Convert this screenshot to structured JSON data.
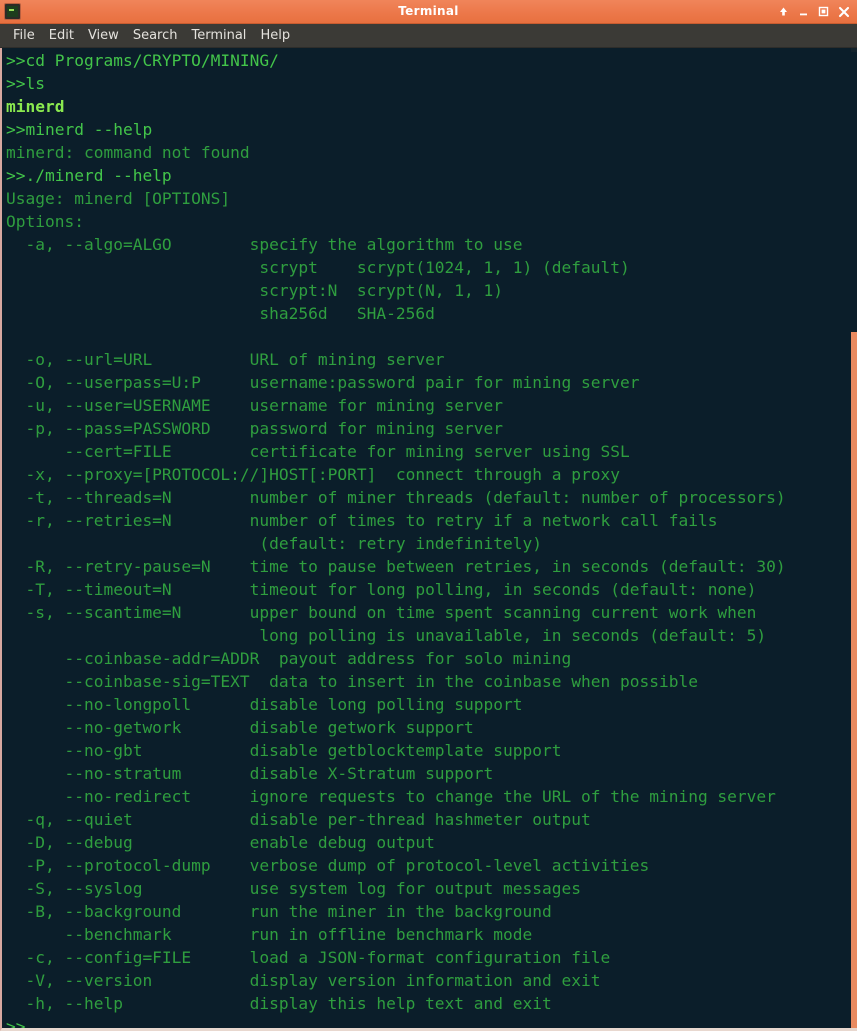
{
  "window": {
    "title": "Terminal",
    "icon": "terminal-icon",
    "accent_color": "#ed7a4d",
    "background_color": "#0b1e2a",
    "text_color": "#2f9e3f",
    "buttons": [
      {
        "name": "shade-button",
        "glyph": "↑"
      },
      {
        "name": "minimize-button",
        "glyph": "–"
      },
      {
        "name": "maximize-button",
        "glyph": "□"
      },
      {
        "name": "close-button",
        "glyph": "✕"
      }
    ]
  },
  "menubar": {
    "items": [
      {
        "label": "File"
      },
      {
        "label": "Edit"
      },
      {
        "label": "View"
      },
      {
        "label": "Search"
      },
      {
        "label": "Terminal"
      },
      {
        "label": "Help"
      }
    ]
  },
  "terminal": {
    "prompt": ">>",
    "scrollbar": {
      "visible": true,
      "thumb_top_pct": 29,
      "thumb_height_pct": 71,
      "color": "#e88a60"
    },
    "lines": [
      {
        "text": ">>cd Programs/CRYPTO/MINING/",
        "style": "cmd"
      },
      {
        "text": ">>ls",
        "style": "cmd"
      },
      {
        "text": "minerd",
        "style": "bright"
      },
      {
        "text": ">>minerd --help",
        "style": "cmd"
      },
      {
        "text": "minerd: command not found",
        "style": "out"
      },
      {
        "text": ">>./minerd --help",
        "style": "cmd"
      },
      {
        "text": "Usage: minerd [OPTIONS]",
        "style": "out"
      },
      {
        "text": "Options:",
        "style": "out"
      },
      {
        "text": "  -a, --algo=ALGO        specify the algorithm to use",
        "style": "out"
      },
      {
        "text": "                          scrypt    scrypt(1024, 1, 1) (default)",
        "style": "out"
      },
      {
        "text": "                          scrypt:N  scrypt(N, 1, 1)",
        "style": "out"
      },
      {
        "text": "                          sha256d   SHA-256d",
        "style": "out"
      },
      {
        "text": "",
        "style": "blank"
      },
      {
        "text": "  -o, --url=URL          URL of mining server",
        "style": "out"
      },
      {
        "text": "  -O, --userpass=U:P     username:password pair for mining server",
        "style": "out"
      },
      {
        "text": "  -u, --user=USERNAME    username for mining server",
        "style": "out"
      },
      {
        "text": "  -p, --pass=PASSWORD    password for mining server",
        "style": "out"
      },
      {
        "text": "      --cert=FILE        certificate for mining server using SSL",
        "style": "out"
      },
      {
        "text": "  -x, --proxy=[PROTOCOL://]HOST[:PORT]  connect through a proxy",
        "style": "out"
      },
      {
        "text": "  -t, --threads=N        number of miner threads (default: number of processors)",
        "style": "out"
      },
      {
        "text": "  -r, --retries=N        number of times to retry if a network call fails",
        "style": "out"
      },
      {
        "text": "                          (default: retry indefinitely)",
        "style": "out"
      },
      {
        "text": "  -R, --retry-pause=N    time to pause between retries, in seconds (default: 30)",
        "style": "out"
      },
      {
        "text": "  -T, --timeout=N        timeout for long polling, in seconds (default: none)",
        "style": "out"
      },
      {
        "text": "  -s, --scantime=N       upper bound on time spent scanning current work when",
        "style": "out"
      },
      {
        "text": "                          long polling is unavailable, in seconds (default: 5)",
        "style": "out"
      },
      {
        "text": "      --coinbase-addr=ADDR  payout address for solo mining",
        "style": "out"
      },
      {
        "text": "      --coinbase-sig=TEXT  data to insert in the coinbase when possible",
        "style": "out"
      },
      {
        "text": "      --no-longpoll      disable long polling support",
        "style": "out"
      },
      {
        "text": "      --no-getwork       disable getwork support",
        "style": "out"
      },
      {
        "text": "      --no-gbt           disable getblocktemplate support",
        "style": "out"
      },
      {
        "text": "      --no-stratum       disable X-Stratum support",
        "style": "out"
      },
      {
        "text": "      --no-redirect      ignore requests to change the URL of the mining server",
        "style": "out"
      },
      {
        "text": "  -q, --quiet            disable per-thread hashmeter output",
        "style": "out"
      },
      {
        "text": "  -D, --debug            enable debug output",
        "style": "out"
      },
      {
        "text": "  -P, --protocol-dump    verbose dump of protocol-level activities",
        "style": "out"
      },
      {
        "text": "  -S, --syslog           use system log for output messages",
        "style": "out"
      },
      {
        "text": "  -B, --background       run the miner in the background",
        "style": "out"
      },
      {
        "text": "      --benchmark        run in offline benchmark mode",
        "style": "out"
      },
      {
        "text": "  -c, --config=FILE      load a JSON-format configuration file",
        "style": "out"
      },
      {
        "text": "  -V, --version          display version information and exit",
        "style": "out"
      },
      {
        "text": "  -h, --help             display this help text and exit",
        "style": "out"
      },
      {
        "text": ">>",
        "style": "cmd"
      }
    ]
  }
}
